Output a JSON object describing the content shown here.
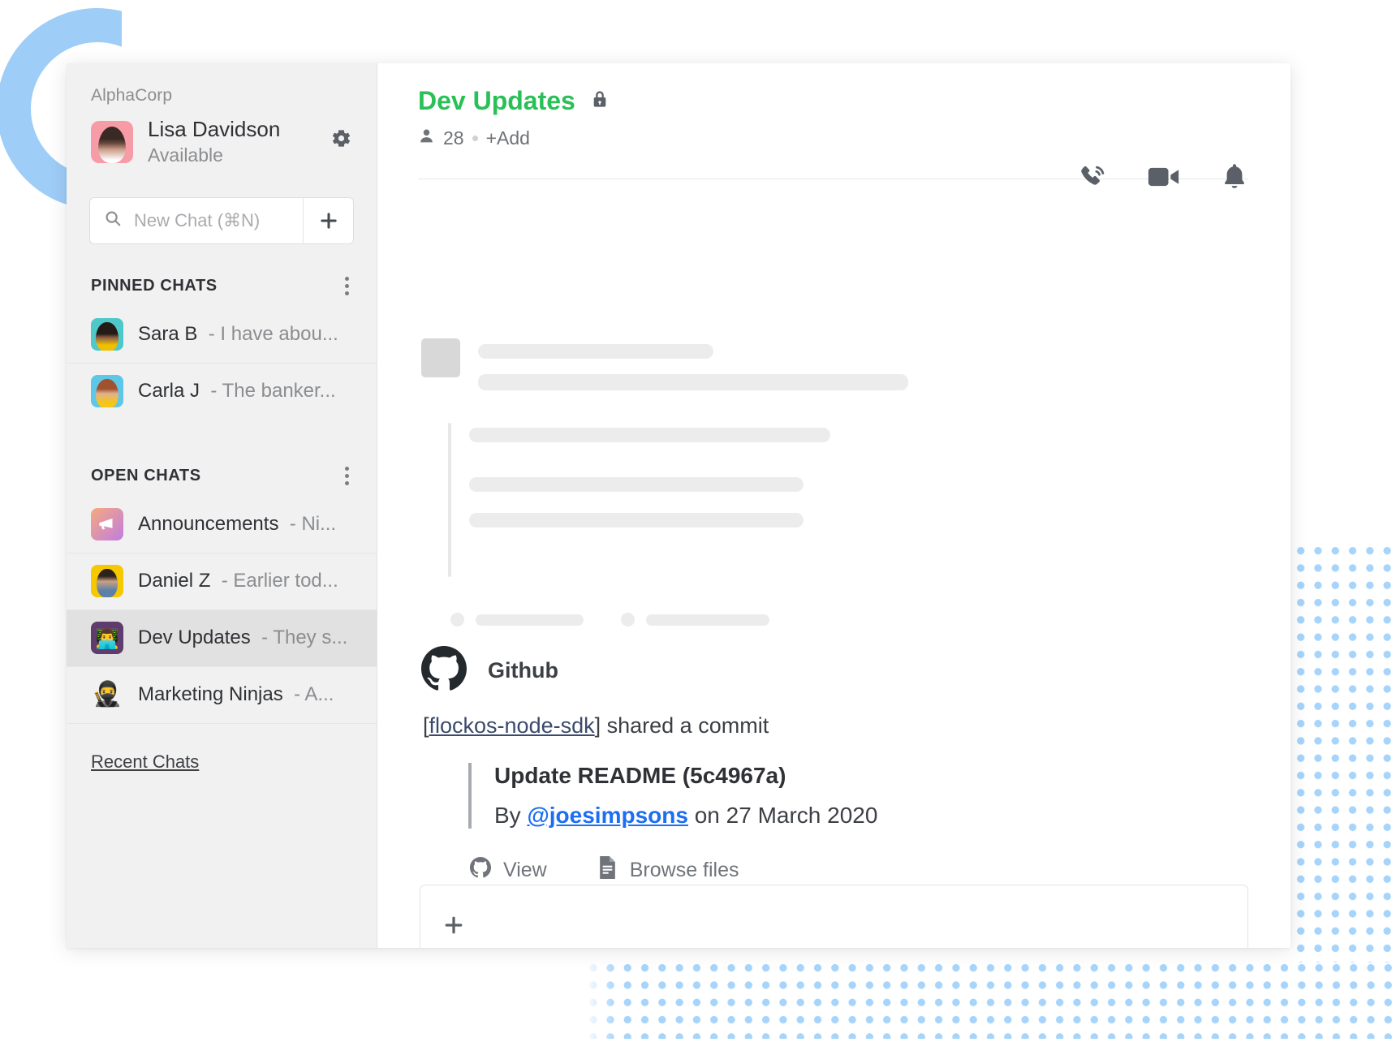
{
  "decor": {
    "ring_color": "#9ecdf7",
    "dot_color": "#a6d4fb"
  },
  "sidebar": {
    "org_name": "AlphaCorp",
    "profile": {
      "name": "Lisa Davidson",
      "status": "Available",
      "avatar_icon": "avatar-lisa-davidson",
      "settings_icon": "gear-icon"
    },
    "search": {
      "placeholder": "New Chat (⌘N)",
      "value": "",
      "icon": "search-icon",
      "add_icon": "plus-icon"
    },
    "sections": [
      {
        "title": "PINNED CHATS",
        "menu_icon": "kebab-menu-icon",
        "chats": [
          {
            "name": "Sara B",
            "preview": "- I have abou...",
            "avatar": "avatar-sara-b",
            "active": false
          },
          {
            "name": "Carla J",
            "preview": "- The banker...",
            "avatar": "avatar-carla-j",
            "active": false
          }
        ]
      },
      {
        "title": "OPEN CHATS",
        "menu_icon": "kebab-menu-icon",
        "chats": [
          {
            "name": "Announcements",
            "preview": "- Ni...",
            "avatar": "avatar-announcements",
            "active": false
          },
          {
            "name": "Daniel Z",
            "preview": "- Earlier tod...",
            "avatar": "avatar-daniel-z",
            "active": false
          },
          {
            "name": "Dev Updates",
            "preview": "- They s...",
            "avatar": "avatar-dev-updates",
            "active": true
          },
          {
            "name": "Marketing Ninjas",
            "preview": "- A...",
            "avatar": "avatar-marketing-ninjas",
            "active": false
          }
        ]
      }
    ],
    "recent_chats_label": "Recent Chats"
  },
  "main": {
    "header": {
      "room_title": "Dev Updates",
      "room_title_color": "#29c057",
      "lock_icon": "lock-icon",
      "member_icon": "person-icon",
      "member_count": "28",
      "add_label": "+Add",
      "actions": [
        {
          "name": "call-button",
          "icon": "phone-icon"
        },
        {
          "name": "video-call-button",
          "icon": "video-camera-icon"
        },
        {
          "name": "notifications-button",
          "icon": "bell-icon"
        }
      ]
    },
    "message": {
      "app_name": "Github",
      "app_icon": "github-icon",
      "repo": "flockos-node-sdk",
      "shared_prefix": "[",
      "shared_suffix": "] shared a commit",
      "commit_title": "Update README (5c4967a)",
      "by_prefix": "By ",
      "author": "@joesimpsons",
      "by_suffix": " on 27 March 2020",
      "actions": [
        {
          "label": "View",
          "icon": "github-icon"
        },
        {
          "label": "Browse files",
          "icon": "file-document-icon"
        }
      ]
    },
    "composer": {
      "placeholder": "",
      "value": "",
      "attach_icon": "plus-icon"
    }
  }
}
